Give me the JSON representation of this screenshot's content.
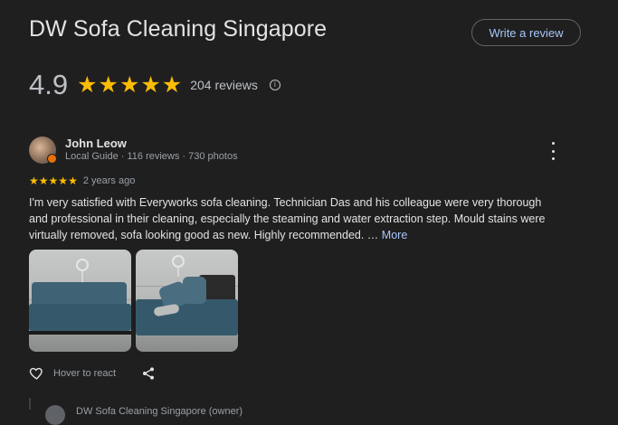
{
  "header": {
    "title": "DW Sofa Cleaning Singapore",
    "write_review_label": "Write a review"
  },
  "summary": {
    "rating": "4.9",
    "stars": "★★★★★",
    "review_count": "204 reviews",
    "info_icon": "info-icon"
  },
  "review": {
    "author": "John Leow",
    "meta": "Local Guide · 116 reviews · 730 photos",
    "stars": "★★★★★",
    "time_ago": "2 years ago",
    "text": "I'm very satisfied with Everyworks sofa cleaning. Technician Das and his colleague were very thorough and professional in their cleaning, especially the steaming and water extraction step. Mould stains were virtually removed, sofa looking good as new. Highly recommended. …",
    "more_label": "More",
    "hover_label": "Hover to react",
    "icons": [
      "heart-icon",
      "share-icon",
      "more-vert-icon"
    ]
  },
  "owner_response": {
    "text": "DW Sofa Cleaning Singapore (owner)"
  },
  "colors": {
    "background": "#1f1f1f",
    "star": "#fbbc04",
    "link": "#a8c7fa"
  }
}
